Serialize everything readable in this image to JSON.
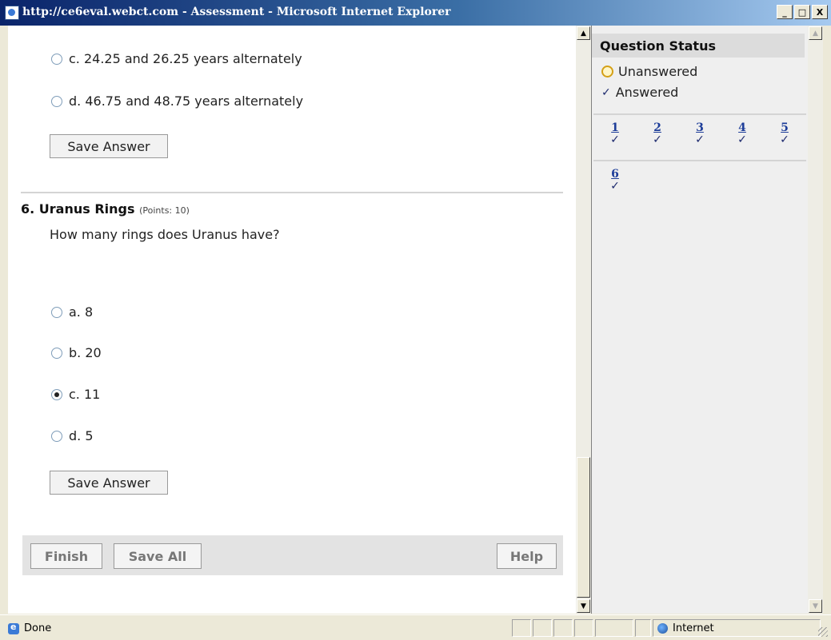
{
  "window": {
    "title": "http://ce6eval.webct.com - Assessment - Microsoft Internet Explorer"
  },
  "window_buttons": {
    "minimize": "_",
    "maximize": "□",
    "close": "X"
  },
  "prev_question": {
    "options": [
      {
        "label": "c. 24.25 and 26.25 years alternately",
        "selected": false
      },
      {
        "label": "d. 46.75 and 48.75 years alternately",
        "selected": false
      }
    ],
    "save_label": "Save Answer"
  },
  "question": {
    "number_title": "6. Uranus Rings",
    "points": "(Points: 10)",
    "text": "How many rings does Uranus have?",
    "options": [
      {
        "label": "a. 8",
        "selected": false
      },
      {
        "label": "b. 20",
        "selected": false
      },
      {
        "label": "c. 11",
        "selected": true
      },
      {
        "label": "d. 5",
        "selected": false
      }
    ],
    "save_label": "Save Answer"
  },
  "footer": {
    "finish": "Finish",
    "save_all": "Save All",
    "help": "Help"
  },
  "status_panel": {
    "title": "Question Status",
    "legend_unanswered": "Unanswered",
    "legend_answered": "Answered",
    "check": "✓",
    "questions": [
      {
        "num": "1",
        "answered": true
      },
      {
        "num": "2",
        "answered": true
      },
      {
        "num": "3",
        "answered": true
      },
      {
        "num": "4",
        "answered": true
      },
      {
        "num": "5",
        "answered": true
      },
      {
        "num": "6",
        "answered": true
      }
    ]
  },
  "statusbar": {
    "text": "Done",
    "zone": "Internet"
  },
  "colors": {
    "titlebar": "#0a246a",
    "link": "#1d3d99",
    "check": "#1d2a6e",
    "unanswered_ring": "#d4a017"
  }
}
